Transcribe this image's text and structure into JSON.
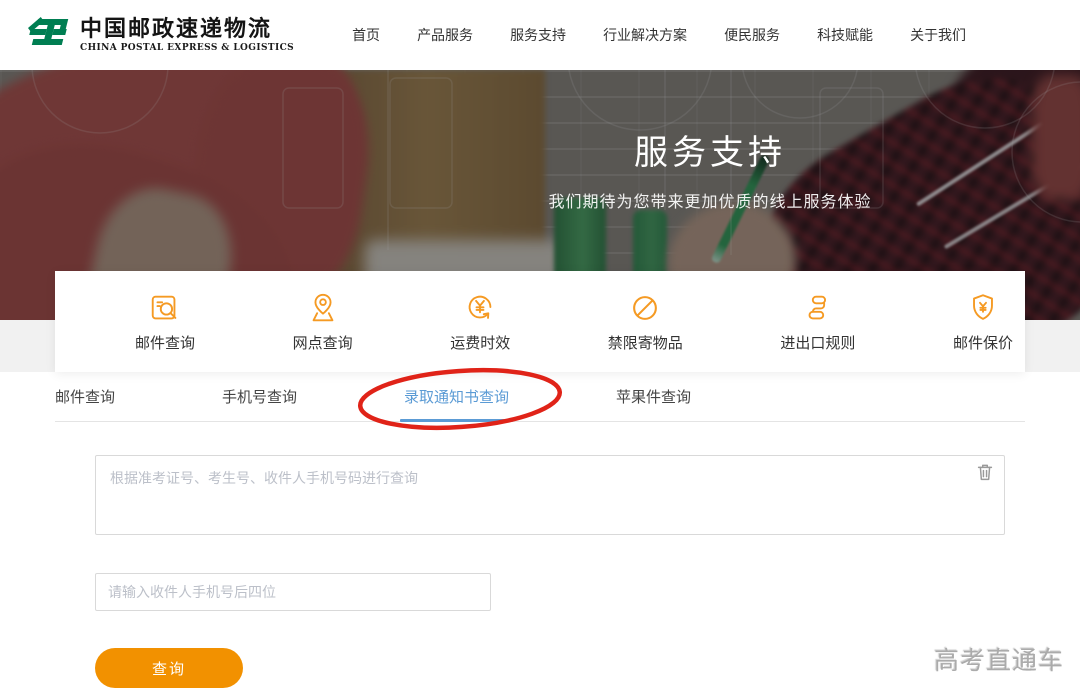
{
  "brand": {
    "logo_cn": "中国邮政速递物流",
    "logo_en": "CHINA POSTAL EXPRESS & LOGISTICS"
  },
  "nav": {
    "items": [
      {
        "label": "首页"
      },
      {
        "label": "产品服务"
      },
      {
        "label": "服务支持"
      },
      {
        "label": "行业解决方案"
      },
      {
        "label": "便民服务"
      },
      {
        "label": "科技赋能"
      },
      {
        "label": "关于我们"
      }
    ]
  },
  "hero": {
    "title": "服务支持",
    "subtitle": "我们期待为您带来更加优质的线上服务体验"
  },
  "services": {
    "items": [
      {
        "label": "邮件查询",
        "icon": "mail-search-icon"
      },
      {
        "label": "网点查询",
        "icon": "location-pin-icon"
      },
      {
        "label": "运费时效",
        "icon": "freight-time-icon"
      },
      {
        "label": "禁限寄物品",
        "icon": "prohibited-items-icon"
      },
      {
        "label": "进出口规则",
        "icon": "import-export-rules-icon"
      },
      {
        "label": "邮件保价",
        "icon": "mail-insurance-icon"
      }
    ]
  },
  "tabs": {
    "items": [
      {
        "label": "邮件查询",
        "active": false
      },
      {
        "label": "手机号查询",
        "active": false
      },
      {
        "label": "录取通知书查询",
        "active": true
      },
      {
        "label": "苹果件查询",
        "active": false
      }
    ]
  },
  "form": {
    "query_placeholder": "根据准考证号、考生号、收件人手机号码进行查询",
    "phone_placeholder": "请输入收件人手机号后四位",
    "submit_label": "查询"
  },
  "watermark": {
    "text": "高考直通车"
  },
  "colors": {
    "brand_green": "#007E52",
    "icon_orange": "#F59A23",
    "button_orange": "#F29100",
    "active_tab_blue": "#5B9BD5",
    "annotation_red": "#E02318"
  }
}
